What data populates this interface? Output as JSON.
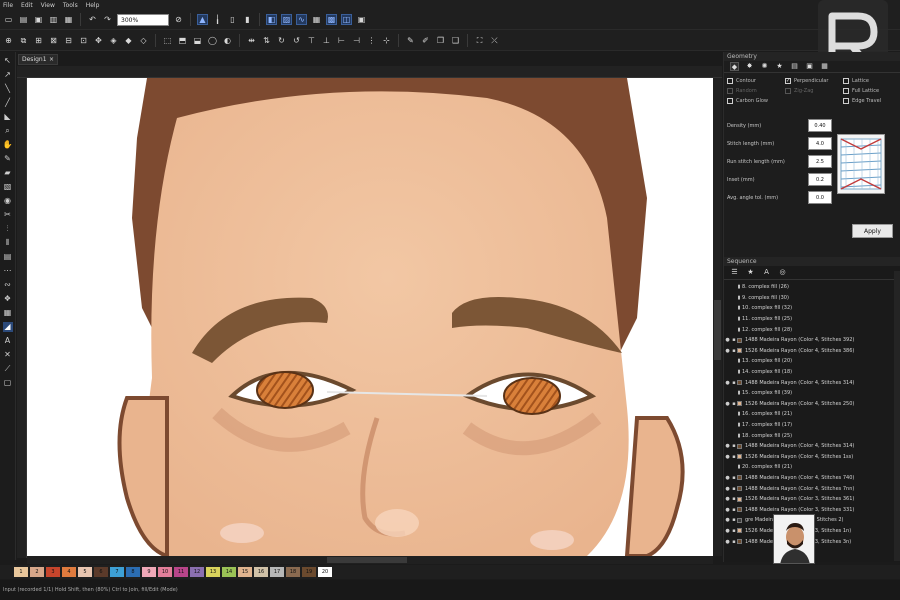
{
  "menu": [
    "File",
    "Edit",
    "View",
    "Tools",
    "Help"
  ],
  "zoom": "300%",
  "document_tab": "Design1",
  "properties": {
    "title": "Geometry",
    "checkboxes": [
      {
        "label": "Contour",
        "checked": false,
        "enabled": true
      },
      {
        "label": "Perpendicular",
        "checked": true,
        "enabled": true
      },
      {
        "label": "Lattice",
        "checked": false,
        "enabled": true
      },
      {
        "label": "Random",
        "checked": false,
        "enabled": false
      },
      {
        "label": "Zig-Zag",
        "checked": false,
        "enabled": false
      },
      {
        "label": "Full Lattice",
        "checked": false,
        "enabled": true
      },
      {
        "label": "Carbon Glow",
        "checked": false,
        "enabled": true
      },
      {
        "label": "",
        "checked": false,
        "enabled": false
      },
      {
        "label": "Edge Travel",
        "checked": false,
        "enabled": true
      }
    ],
    "fields": [
      {
        "label": "Density (mm)",
        "value": "0.40"
      },
      {
        "label": "Stitch length (mm)",
        "value": "4.0"
      },
      {
        "label": "Run stitch length (mm)",
        "value": "2.5"
      },
      {
        "label": "Inset (mm)",
        "value": "0.2"
      },
      {
        "label": "Avg. angle tol. (mm)",
        "value": "0.0"
      }
    ],
    "apply_label": "Apply"
  },
  "sequence": {
    "title": "Sequence",
    "rows": [
      {
        "text": "8. complex fill (26)",
        "child": true,
        "color": ""
      },
      {
        "text": "9. complex fill (30)",
        "child": true,
        "color": ""
      },
      {
        "text": "10. complex fill (32)",
        "child": true,
        "color": ""
      },
      {
        "text": "11. complex fill (25)",
        "child": true,
        "color": ""
      },
      {
        "text": "12. complex fill (28)",
        "child": true,
        "color": ""
      },
      {
        "text": "1488 Madeira Rayon (Color 4, Stitches 392)",
        "child": false,
        "color": "#6b4a2e"
      },
      {
        "text": "1526 Madeira Rayon (Color 4, Stitches 386)",
        "child": false,
        "color": "#e0b48f"
      },
      {
        "text": "13. complex fill (20)",
        "child": true,
        "color": ""
      },
      {
        "text": "14. complex fill (18)",
        "child": true,
        "color": ""
      },
      {
        "text": "1488 Madeira Rayon (Color 4, Stitches 314)",
        "child": false,
        "color": "#6b4a2e"
      },
      {
        "text": "15. complex fill (39)",
        "child": true,
        "color": ""
      },
      {
        "text": "1526 Madeira Rayon (Color 4, Stitches 250)",
        "child": false,
        "color": "#e0b48f"
      },
      {
        "text": "16. complex fill (21)",
        "child": true,
        "color": ""
      },
      {
        "text": "17. complex fill (17)",
        "child": true,
        "color": ""
      },
      {
        "text": "18. complex fill (25)",
        "child": true,
        "color": ""
      },
      {
        "text": "1488 Madeira Rayon (Color 4, Stitches 314)",
        "child": false,
        "color": "#6b4a2e"
      },
      {
        "text": "1526 Madeira Rayon (Color 4, Stitches 1ss)",
        "child": false,
        "color": "#e0b48f"
      },
      {
        "text": "20. complex fill (21)",
        "child": true,
        "color": ""
      },
      {
        "text": "1488 Madeira Rayon (Color 4, Stitches 740)",
        "child": false,
        "color": "#6b4a2e"
      },
      {
        "text": "1488 Madeira Rayon (Color 4, Stitches 7nn)",
        "child": false,
        "color": "#6b4a2e"
      },
      {
        "text": "1526 Madeira Rayon (Color 3, Stitches 361)",
        "child": false,
        "color": "#e0b48f"
      },
      {
        "text": "1488 Madeira Rayon (Color 3, Stitches 331)",
        "child": false,
        "color": "#6b4a2e"
      },
      {
        "text": "gre Madeira Rayon (Color 2, Stitches 2)",
        "child": false,
        "color": "#3a3a3a"
      },
      {
        "text": "1526 Madeira Rayon (Color 3, Stitches 1n)",
        "child": false,
        "color": "#e0b48f"
      },
      {
        "text": "1488 Madeira Rayon (Color 3, Stitches 3n)",
        "child": false,
        "color": "#6b4a2e"
      }
    ]
  },
  "palette": {
    "swatches": [
      {
        "label": "1",
        "color": "#e9c79c"
      },
      {
        "label": "2",
        "color": "#d8a78a"
      },
      {
        "label": "3",
        "color": "#c7452c"
      },
      {
        "label": "4",
        "color": "#e07b3e"
      },
      {
        "label": "5",
        "color": "#e8c5b0"
      },
      {
        "label": "6",
        "color": "#5b3a2a"
      },
      {
        "label": "7",
        "color": "#3da0d6"
      },
      {
        "label": "8",
        "color": "#2b6db3"
      },
      {
        "label": "9",
        "color": "#f0a8b8"
      },
      {
        "label": "10",
        "color": "#e37e9a"
      },
      {
        "label": "11",
        "color": "#b9458a"
      },
      {
        "label": "12",
        "color": "#8b6fb0"
      },
      {
        "label": "13",
        "color": "#d9d35c"
      },
      {
        "label": "14",
        "color": "#9bc256"
      },
      {
        "label": "15",
        "color": "#e0b48f"
      },
      {
        "label": "16",
        "color": "#d1c2a8"
      },
      {
        "label": "17",
        "color": "#b7b7b7"
      },
      {
        "label": "18",
        "color": "#8a6a50"
      },
      {
        "label": "19",
        "color": "#6b4a2e"
      },
      {
        "label": "20",
        "color": "#ffffff"
      }
    ]
  },
  "status_text": "Input (recorded 1/1)  Hold Shift, then (80%) Ctrl to Join, fill/Edit (Mode)"
}
